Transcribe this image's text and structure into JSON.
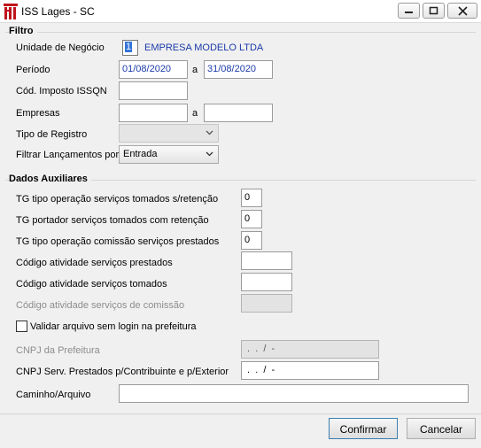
{
  "window": {
    "title": "ISS Lages - SC"
  },
  "filtro": {
    "title": "Filtro",
    "unidade_label": "Unidade de Negócio",
    "unidade_code": "1",
    "unidade_name": "EMPRESA MODELO LTDA",
    "periodo_label": "Período",
    "periodo_from": "01/08/2020",
    "periodo_sep": "a",
    "periodo_to": "31/08/2020",
    "cod_imposto_label": "Cód. Imposto ISSQN",
    "cod_imposto_value": "",
    "empresas_label": "Empresas",
    "empresas_from": "",
    "empresas_sep": "a",
    "empresas_to": "",
    "tipo_registro_label": "Tipo de Registro",
    "tipo_registro_value": "",
    "filtrar_label": "Filtrar Lançamentos por",
    "filtrar_value": "Entrada"
  },
  "auxiliares": {
    "title": "Dados Auxiliares",
    "tg_tomados_label": "TG tipo operação serviços tomados s/retenção",
    "tg_tomados_value": "0",
    "tg_portador_label": "TG portador serviços tomados com retenção",
    "tg_portador_value": "0",
    "tg_comissao_label": "TG tipo operação comissão serviços prestados",
    "tg_comissao_value": "0",
    "cod_prestados_label": "Código atividade serviços prestados",
    "cod_prestados_value": "",
    "cod_tomados_label": "Código atividade serviços tomados",
    "cod_tomados_value": "",
    "cod_comissao_label": "Código atividade serviços de comissão",
    "cod_comissao_value": "",
    "validar_label": "Validar arquivo sem login na prefeitura",
    "validar_checked": false,
    "cnpj_prefeitura_label": "CNPJ da Prefeitura",
    "cnpj_prefeitura_value": " .  .  /  -",
    "cnpj_serv_label": "CNPJ Serv. Prestados p/Contribuinte e p/Exterior",
    "cnpj_serv_value": " .  .  /  -",
    "caminho_label": "Caminho/Arquivo",
    "caminho_value": ""
  },
  "buttons": {
    "confirmar": "Confirmar",
    "cancelar": "Cancelar"
  },
  "colors": {
    "accent": "#1a3aa8",
    "icon_red": "#c0141c"
  }
}
